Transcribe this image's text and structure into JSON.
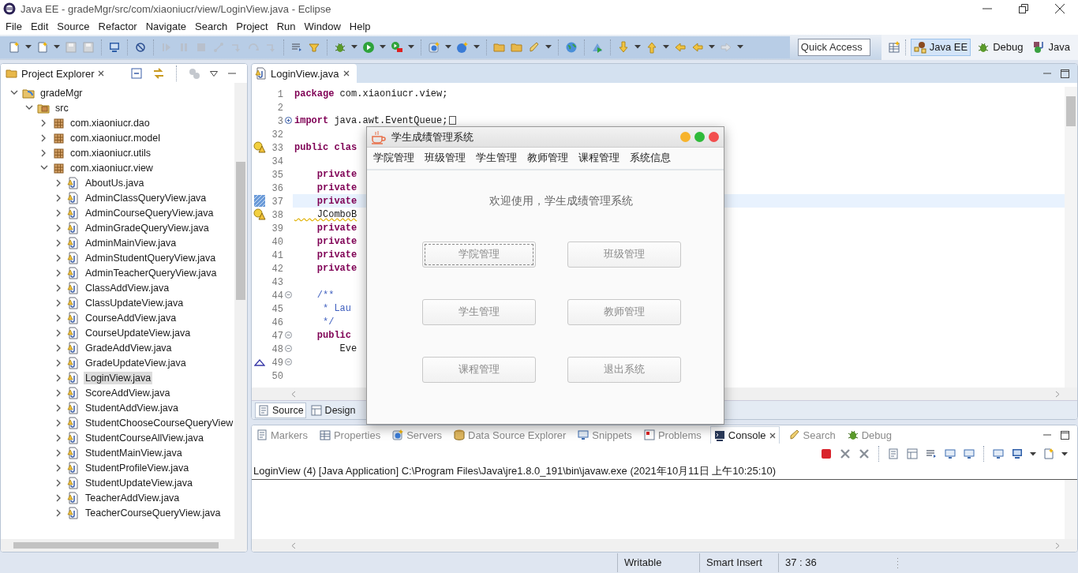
{
  "window": {
    "title": "Java EE - gradeMgr/src/com/xiaoniucr/view/LoginView.java - Eclipse"
  },
  "menu_bar": [
    "File",
    "Edit",
    "Source",
    "Refactor",
    "Navigate",
    "Search",
    "Project",
    "Run",
    "Window",
    "Help"
  ],
  "toolbar": {
    "quick_access": {
      "placeholder": "Quick Access"
    },
    "perspectives": [
      {
        "label": "Java EE",
        "kind": "javaee",
        "selected": true
      },
      {
        "label": "Debug",
        "kind": "debug",
        "selected": false
      },
      {
        "label": "Java",
        "kind": "java",
        "selected": false
      }
    ]
  },
  "project_explorer": {
    "title": "Project Explorer",
    "tree": [
      {
        "label": "gradeMgr",
        "kind": "project",
        "expanded": true,
        "selected": false,
        "children": [
          {
            "label": "src",
            "kind": "source_folder",
            "expanded": true,
            "selected": false,
            "children": [
              {
                "label": "com.xiaoniucr.dao",
                "kind": "package",
                "expanded": false,
                "selected": false
              },
              {
                "label": "com.xiaoniucr.model",
                "kind": "package",
                "expanded": false,
                "selected": false
              },
              {
                "label": "com.xiaoniucr.utils",
                "kind": "package",
                "expanded": false,
                "selected": false
              },
              {
                "label": "com.xiaoniucr.view",
                "kind": "package",
                "expanded": true,
                "selected": false,
                "children": [
                  {
                    "label": "AboutUs.java",
                    "kind": "file",
                    "expanded": false,
                    "selected": false
                  },
                  {
                    "label": "AdminClassQueryView.java",
                    "kind": "file",
                    "expanded": false,
                    "selected": false
                  },
                  {
                    "label": "AdminCourseQueryView.java",
                    "kind": "file",
                    "expanded": false,
                    "selected": false
                  },
                  {
                    "label": "AdminGradeQueryView.java",
                    "kind": "file",
                    "expanded": false,
                    "selected": false
                  },
                  {
                    "label": "AdminMainView.java",
                    "kind": "file",
                    "expanded": false,
                    "selected": false
                  },
                  {
                    "label": "AdminStudentQueryView.java",
                    "kind": "file",
                    "expanded": false,
                    "selected": false
                  },
                  {
                    "label": "AdminTeacherQueryView.java",
                    "kind": "file",
                    "expanded": false,
                    "selected": false
                  },
                  {
                    "label": "ClassAddView.java",
                    "kind": "file",
                    "expanded": false,
                    "selected": false
                  },
                  {
                    "label": "ClassUpdateView.java",
                    "kind": "file",
                    "expanded": false,
                    "selected": false
                  },
                  {
                    "label": "CourseAddView.java",
                    "kind": "file",
                    "expanded": false,
                    "selected": false
                  },
                  {
                    "label": "CourseUpdateView.java",
                    "kind": "file",
                    "expanded": false,
                    "selected": false
                  },
                  {
                    "label": "GradeAddView.java",
                    "kind": "file",
                    "expanded": false,
                    "selected": false
                  },
                  {
                    "label": "GradeUpdateView.java",
                    "kind": "file",
                    "expanded": false,
                    "selected": false
                  },
                  {
                    "label": "LoginView.java",
                    "kind": "file",
                    "expanded": false,
                    "selected": true
                  },
                  {
                    "label": "ScoreAddView.java",
                    "kind": "file",
                    "expanded": false,
                    "selected": false
                  },
                  {
                    "label": "StudentAddView.java",
                    "kind": "file",
                    "expanded": false,
                    "selected": false
                  },
                  {
                    "label": "StudentChooseCourseQueryView",
                    "kind": "file",
                    "expanded": false,
                    "selected": false
                  },
                  {
                    "label": "StudentCourseAllView.java",
                    "kind": "file",
                    "expanded": false,
                    "selected": false
                  },
                  {
                    "label": "StudentMainView.java",
                    "kind": "file",
                    "expanded": false,
                    "selected": false
                  },
                  {
                    "label": "StudentProfileView.java",
                    "kind": "file",
                    "expanded": false,
                    "selected": false
                  },
                  {
                    "label": "StudentUpdateView.java",
                    "kind": "file",
                    "expanded": false,
                    "selected": false
                  },
                  {
                    "label": "TeacherAddView.java",
                    "kind": "file",
                    "expanded": false,
                    "selected": false
                  },
                  {
                    "label": "TeacherCourseQueryView.java",
                    "kind": "file",
                    "expanded": false,
                    "selected": false
                  }
                ]
              }
            ]
          }
        ]
      }
    ]
  },
  "editor": {
    "tab": "LoginView.java",
    "lines": [
      {
        "number": "1",
        "code": "**package** com.xiaoniucr.view;"
      },
      {
        "number": "2"
      },
      {
        "number": "3",
        "code": "**import** java.awt.EventQueue;",
        "collapsed": true
      },
      {
        "number": "32"
      },
      {
        "number": "33",
        "code": "**public clas**",
        "warning": true
      },
      {
        "number": "34"
      },
      {
        "number": "35",
        "code": "    **private**"
      },
      {
        "number": "36",
        "code": "    **private**"
      },
      {
        "number": "37",
        "code": "    **private**",
        "bookmark": true,
        "current_line": true
      },
      {
        "number": "38",
        "code": "    JComboB",
        "warning": true,
        "warning_underline": true
      },
      {
        "number": "39",
        "code": "    **private**"
      },
      {
        "number": "40",
        "code": "    **private**"
      },
      {
        "number": "41",
        "code": "    **private**"
      },
      {
        "number": "42",
        "code": "    **private**"
      },
      {
        "number": "43"
      },
      {
        "number": "44",
        "code": "    /**",
        "kind": "comment",
        "collapsed": false
      },
      {
        "number": "45",
        "code": "     * Lau",
        "kind": "comment"
      },
      {
        "number": "46",
        "code": "     */",
        "kind": "comment"
      },
      {
        "number": "47",
        "code": "    **public**",
        "collapsed": false
      },
      {
        "number": "48",
        "code": "        Eve",
        "collapsed": false
      },
      {
        "number": "49",
        "override": true,
        "collapsed": false
      },
      {
        "number": "50"
      }
    ],
    "bottom_tabs": [
      {
        "label": "Source",
        "selected": true
      },
      {
        "label": "Design",
        "selected": false
      }
    ]
  },
  "bottom_panel": {
    "tabs": [
      {
        "label": "Markers",
        "kind": "markers",
        "selected": false
      },
      {
        "label": "Properties",
        "kind": "properties",
        "selected": false
      },
      {
        "label": "Servers",
        "kind": "servers",
        "selected": false
      },
      {
        "label": "Data Source Explorer",
        "kind": "datasource",
        "selected": false
      },
      {
        "label": "Snippets",
        "kind": "snippets",
        "selected": false
      },
      {
        "label": "Problems",
        "kind": "problems",
        "selected": false
      },
      {
        "label": "Console",
        "kind": "console",
        "selected": true
      },
      {
        "label": "Search",
        "kind": "search",
        "selected": false
      },
      {
        "label": "Debug",
        "kind": "debug",
        "selected": false
      }
    ],
    "console_header": "LoginView (4) [Java Application] C:\\Program Files\\Java\\jre1.8.0_191\\bin\\javaw.exe (2021年10月11日 上午10:25:10)"
  },
  "status_bar": [
    "Writable",
    "Smart Insert",
    "37 : 36"
  ],
  "dialog": {
    "title": "学生成绩管理系统",
    "menu": [
      "学院管理",
      "班级管理",
      "学生管理",
      "教师管理",
      "课程管理",
      "系统信息"
    ],
    "welcome": "欢迎使用，学生成绩管理系统",
    "buttons": [
      {
        "label": "学院管理",
        "focused": true
      },
      {
        "label": "班级管理",
        "focused": false
      },
      {
        "label": "学生管理",
        "focused": false
      },
      {
        "label": "教师管理",
        "focused": false
      },
      {
        "label": "课程管理",
        "focused": false
      },
      {
        "label": "退出系统",
        "focused": false
      }
    ]
  }
}
